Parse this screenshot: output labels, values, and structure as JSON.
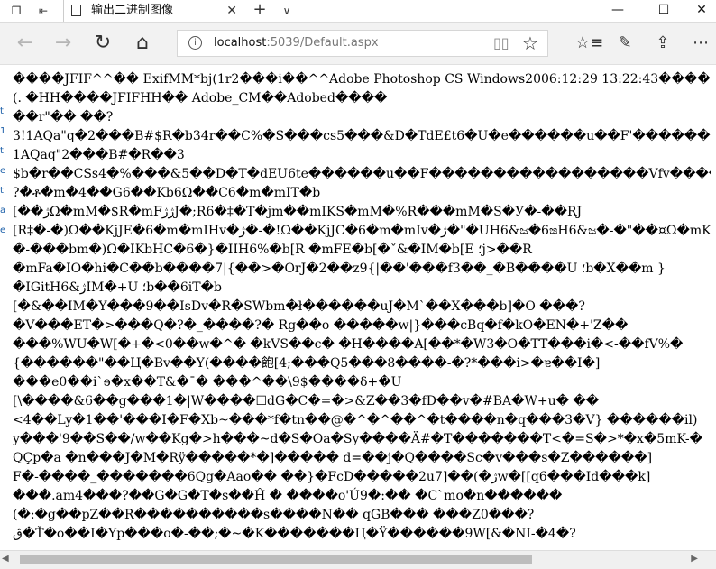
{
  "window": {
    "tab_title": "输出二进制图像",
    "tab_close": "✕",
    "new_tab": "+",
    "tab_menu": "∨",
    "minimize": "—",
    "maximize": "☐",
    "close": "✕"
  },
  "nav": {
    "back": "←",
    "forward": "→",
    "refresh": "↻",
    "home": "⌂",
    "url_host": "localhost",
    "url_rest": ":5039/Default.aspx"
  },
  "content": {
    "lines": [
      "����JFIF^^�� ExifMM*bj(1r2���i��^^Adobe Photoshop CS Windows2006:12:29 13:22:43���� �8&",
      "(. �HH����JFIFHH�� Adobe_CM��Adobed����",
      "��r\"�� ��?",
      "3!1AQa\"q�2���B#$R�b34r��C%�S���cs5���&D�TdE£t6�U�e������u��F'�������",
      "1AQaq\"2���B#�R��3",
      "$b�r��CSs4�%���&5��D�T�dEU6te������u��F�����������������Vfv����",
      "?�ቶ�m�4��G6��Kb6Ω��C6�m�mIT�b",
      "[��ژΩ�mM�$R�mFژژJ�;R6�‡�T�jm��mIKS�mM�%R���mM�S�У�-��RJ",
      "[R‡�-�)Ω��KjJE�6�m�mIHv�ژ�-�!Ω��KjJC�6�m�mIv�ژ�\"�UH6&ಜ�6ಙH6&ಜ�-�\"��¤Ω�mK",
      "�-���bm�)Ω�IKbHC�6�}�IIH6%�b[R �mFE�b[�ˇ&�IM�b[E ؛j>��R",
      "�mFa�IO�hi�C��b����7|{��>�OrJ�2��z9{|��'���f3��_�B����U ؛b�X��m }",
      "�IGitH6&ژIM�+U ؛b��6iT�b",
      "[�&��IM�Y���9��IsDv�R�SWbm�ł������uJ�M`��X���b]�O ���?",
      "�V���ET�>���Q�?�_����?� Rg��o �����w|}���cBq�f�kO�EN�+'Z��",
      "���%WU�W[�+�<0��w�^� �kVS��c�   �H����A[��*�W3�O�TT���i�<-��fV%�",
      "{������\"��Ц�Bv��Y(����飽[4;���Q5���8����-�?*���i>�ɐ��I�]",
      "���e0��i`ɘ�x��T&�¯� ���^��\\9$����δ+�U",
      "[\\����&6��g���1�|W����☐dG�C�=�>&Z��3�fD��v�#BA�W+u� ��",
      "<4��Ly�1��'���I�F�Xb~���*f�tn��@�^�^��^�t����n�q���3�V}  ������il)",
      "y���'9��S��/w��Kg�>h���~d�S�Oa�Sy����Ä#�T�������T<�=S�>*�x�5mK-�",
      "QÇp�a �n���J�M�Rÿ�����*�]�����  d=��j�Q����Sc�v���s�Z������]",
      "F�-����_�������6Qg�Aao�� ��}�FcD�����2u7]��(�ژw�[[q6���Id���k]",
      "���.am4���?��G�G�T�s��Ĥ � ����o'Ú9�:�� �C`mo�n������",
      "(�:�g��pZ��R����������s����N�� qGB��� ���Z0���?",
      "ڨ�Ť�o��I�Yp���o�-��;�~�K�������Ц�Ÿ������9W[&�NI-�4�?"
    ],
    "margin_marks": [
      "t",
      "1",
      "t",
      "e",
      "t",
      "a",
      "e"
    ]
  },
  "scrollbar": {
    "left_arrow": "◀",
    "right_arrow": "▶"
  }
}
